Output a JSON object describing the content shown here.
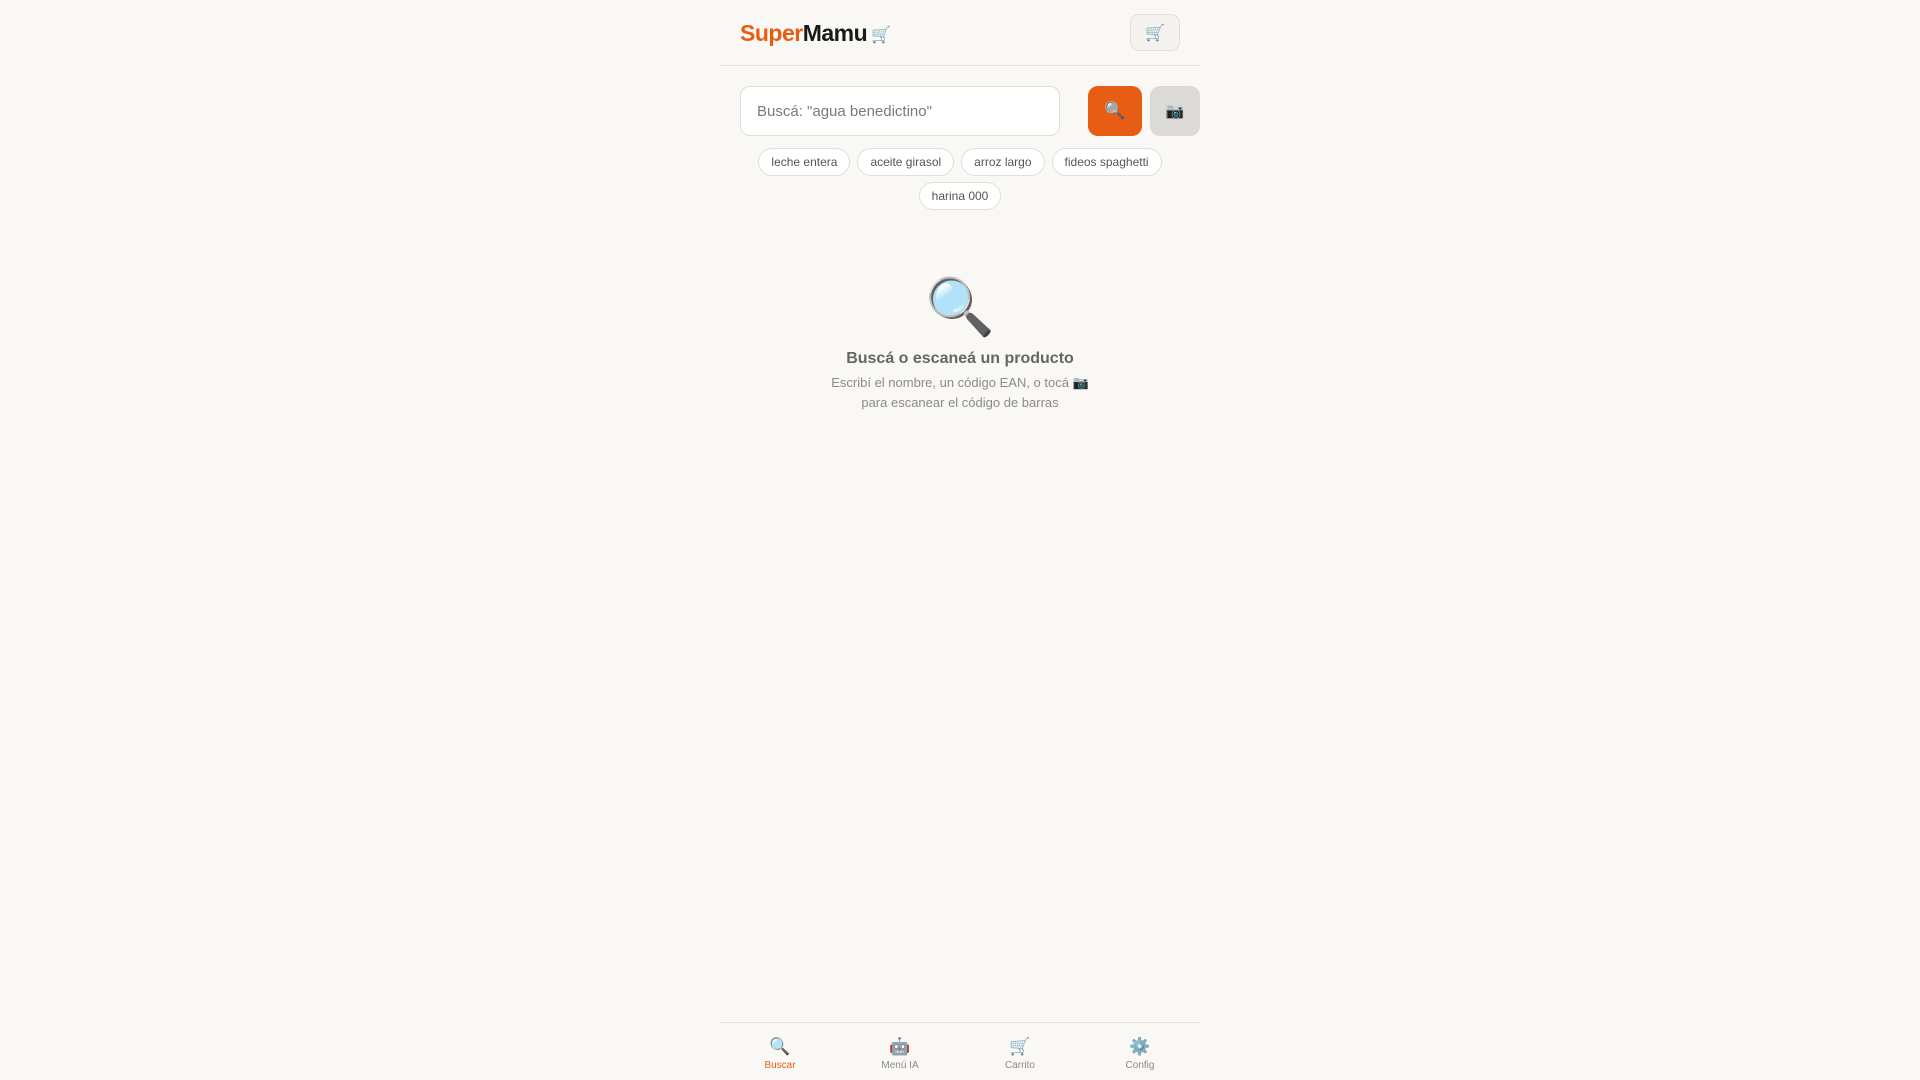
{
  "header": {
    "logo_super": "Super",
    "logo_mamu": "Mamu",
    "logo_icon": "🛒",
    "cart_button_icon": "🛒"
  },
  "search": {
    "placeholder": "Buscá: \"agua benedictino\"",
    "value": "",
    "search_button_icon": "🔍",
    "scan_button_icon": "📷"
  },
  "suggestions": [
    "leche entera",
    "aceite girasol",
    "arroz largo",
    "fideos spaghetti",
    "harina 000"
  ],
  "empty_state": {
    "icon": "🔍",
    "title": "Buscá o escaneá un producto",
    "description_line1": "Escribí el nombre, un código EAN, o tocá 📷",
    "description_line2": "para escanear el código de barras"
  },
  "bottom_nav": [
    {
      "icon": "🔍",
      "label": "Buscar",
      "active": true
    },
    {
      "icon": "🤖",
      "label": "Menú IA",
      "active": false
    },
    {
      "icon": "🛒",
      "label": "Carrito",
      "active": false
    },
    {
      "icon": "⚙️",
      "label": "Config",
      "active": false
    }
  ],
  "colors": {
    "accent": "#e85d14",
    "background": "#faf8f5"
  }
}
